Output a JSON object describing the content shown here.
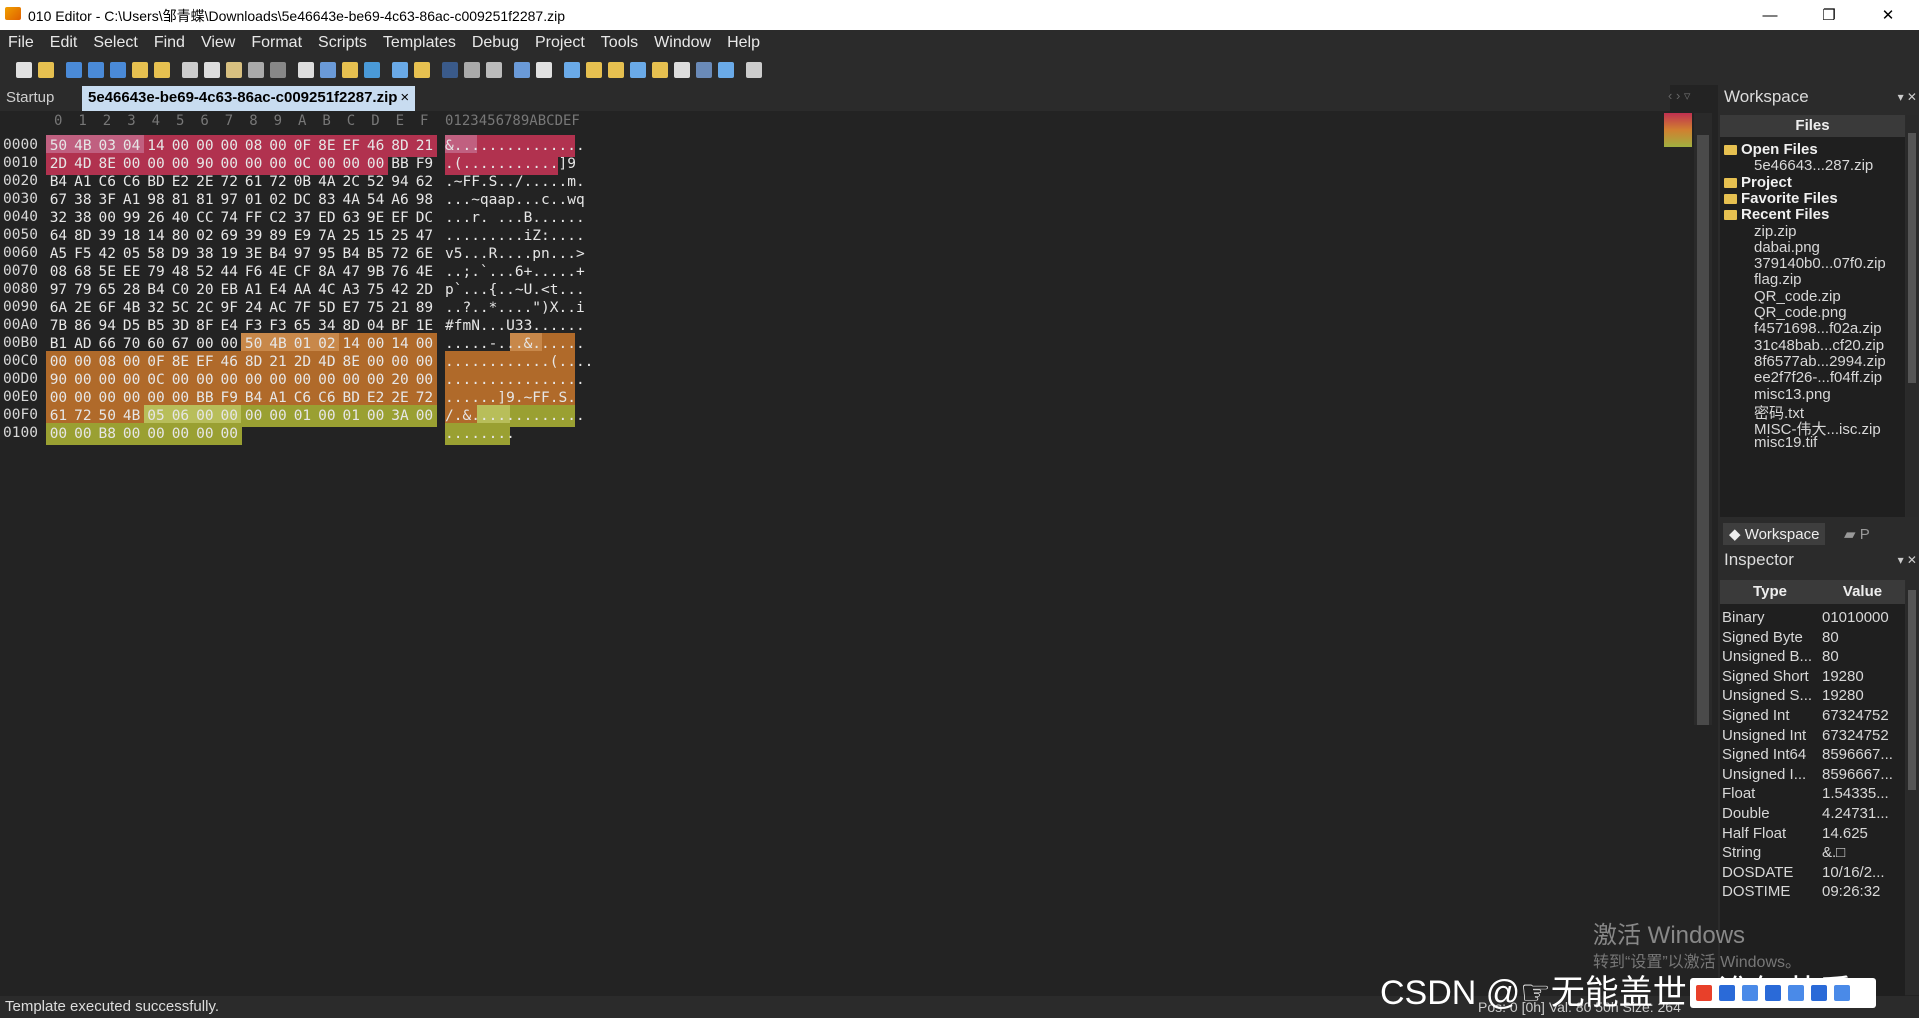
{
  "window": {
    "title": "010 Editor - C:\\Users\\邹青蝶\\Downloads\\5e46643e-be69-4c63-86ac-c009251f2287.zip"
  },
  "menu": [
    "File",
    "Edit",
    "Select",
    "Find",
    "View",
    "Format",
    "Scripts",
    "Templates",
    "Debug",
    "Project",
    "Tools",
    "Window",
    "Help"
  ],
  "tabs": {
    "startup": "Startup",
    "file": "5e46643e-be69-4c63-86ac-c009251f2287.zip",
    "close": "×"
  },
  "hex": {
    "col_headers": [
      "0",
      "1",
      "2",
      "3",
      "4",
      "5",
      "6",
      "7",
      "8",
      "9",
      "A",
      "B",
      "C",
      "D",
      "E",
      "F"
    ],
    "ascii_header": "0123456789ABCDEF",
    "rows": [
      {
        "offset": "0000",
        "bytes": [
          "50",
          "4B",
          "03",
          "04",
          "14",
          "00",
          "00",
          "00",
          "08",
          "00",
          "0F",
          "8E",
          "EF",
          "46",
          "8D",
          "21"
        ],
        "ascii": "&..............."
      },
      {
        "offset": "0010",
        "bytes": [
          "2D",
          "4D",
          "8E",
          "00",
          "00",
          "00",
          "90",
          "00",
          "00",
          "00",
          "0C",
          "00",
          "00",
          "00",
          "BB",
          "F9"
        ],
        "ascii": ".(...........]9"
      },
      {
        "offset": "0020",
        "bytes": [
          "B4",
          "A1",
          "C6",
          "C6",
          "BD",
          "E2",
          "2E",
          "72",
          "61",
          "72",
          "0B",
          "4A",
          "2C",
          "52",
          "94",
          "62"
        ],
        "ascii": ".~FF.S../.....m."
      },
      {
        "offset": "0030",
        "bytes": [
          "67",
          "38",
          "3F",
          "A1",
          "98",
          "81",
          "81",
          "97",
          "01",
          "02",
          "DC",
          "83",
          "4A",
          "54",
          "A6",
          "98"
        ],
        "ascii": "...~qaap...c..wq"
      },
      {
        "offset": "0040",
        "bytes": [
          "32",
          "38",
          "00",
          "99",
          "26",
          "40",
          "CC",
          "74",
          "FF",
          "C2",
          "37",
          "ED",
          "63",
          "9E",
          "EF",
          "DC"
        ],
        "ascii": "...r. ...B......"
      },
      {
        "offset": "0050",
        "bytes": [
          "64",
          "8D",
          "39",
          "18",
          "14",
          "80",
          "02",
          "69",
          "39",
          "89",
          "E9",
          "7A",
          "25",
          "15",
          "25",
          "47"
        ],
        "ascii": ".........iZ:...."
      },
      {
        "offset": "0060",
        "bytes": [
          "A5",
          "F5",
          "42",
          "05",
          "58",
          "D9",
          "38",
          "19",
          "3E",
          "B4",
          "97",
          "95",
          "B4",
          "B5",
          "72",
          "6E"
        ],
        "ascii": "v5...R....pn...>"
      },
      {
        "offset": "0070",
        "bytes": [
          "08",
          "68",
          "5E",
          "EE",
          "79",
          "48",
          "52",
          "44",
          "F6",
          "4E",
          "CF",
          "8A",
          "47",
          "9B",
          "76",
          "4E"
        ],
        "ascii": "..;.`...6+.....+"
      },
      {
        "offset": "0080",
        "bytes": [
          "97",
          "79",
          "65",
          "28",
          "B4",
          "C0",
          "20",
          "EB",
          "A1",
          "E4",
          "AA",
          "4C",
          "A3",
          "75",
          "42",
          "2D"
        ],
        "ascii": "p`...{..~U.<t..."
      },
      {
        "offset": "0090",
        "bytes": [
          "6A",
          "2E",
          "6F",
          "4B",
          "32",
          "5C",
          "2C",
          "9F",
          "24",
          "AC",
          "7F",
          "5D",
          "E7",
          "75",
          "21",
          "89"
        ],
        "ascii": "..?..*....\")X..i"
      },
      {
        "offset": "00A0",
        "bytes": [
          "7B",
          "86",
          "94",
          "D5",
          "B5",
          "3D",
          "8F",
          "E4",
          "F3",
          "F3",
          "65",
          "34",
          "8D",
          "04",
          "BF",
          "1E"
        ],
        "ascii": "#fmN...U33......"
      },
      {
        "offset": "00B0",
        "bytes": [
          "B1",
          "AD",
          "66",
          "70",
          "60",
          "67",
          "00",
          "00",
          "50",
          "4B",
          "01",
          "02",
          "14",
          "00",
          "14",
          "00"
        ],
        "ascii": ".....-...&......"
      },
      {
        "offset": "00C0",
        "bytes": [
          "00",
          "00",
          "08",
          "00",
          "0F",
          "8E",
          "EF",
          "46",
          "8D",
          "21",
          "2D",
          "4D",
          "8E",
          "00",
          "00",
          "00"
        ],
        "ascii": "............(...."
      },
      {
        "offset": "00D0",
        "bytes": [
          "90",
          "00",
          "00",
          "00",
          "0C",
          "00",
          "00",
          "00",
          "00",
          "00",
          "00",
          "00",
          "00",
          "00",
          "20",
          "00"
        ],
        "ascii": "................"
      },
      {
        "offset": "00E0",
        "bytes": [
          "00",
          "00",
          "00",
          "00",
          "00",
          "00",
          "BB",
          "F9",
          "B4",
          "A1",
          "C6",
          "C6",
          "BD",
          "E2",
          "2E",
          "72"
        ],
        "ascii": "......]9.~FF.S."
      },
      {
        "offset": "00F0",
        "bytes": [
          "61",
          "72",
          "50",
          "4B",
          "05",
          "06",
          "00",
          "00",
          "00",
          "00",
          "01",
          "00",
          "01",
          "00",
          "3A",
          "00"
        ],
        "ascii": "/.&............."
      },
      {
        "offset": "0100",
        "bytes": [
          "00",
          "00",
          "B8",
          "00",
          "00",
          "00",
          "00",
          "00"
        ],
        "ascii": "........"
      }
    ]
  },
  "workspace": {
    "title": "Workspace",
    "files_header": "Files",
    "items": [
      {
        "label": "Open Files",
        "type": "category"
      },
      {
        "label": "5e46643...287.zip",
        "type": "item"
      },
      {
        "label": "Project",
        "type": "category"
      },
      {
        "label": "Favorite Files",
        "type": "category"
      },
      {
        "label": "Recent Files",
        "type": "category"
      },
      {
        "label": "zip.zip",
        "type": "item"
      },
      {
        "label": "dabai.png",
        "type": "item"
      },
      {
        "label": "379140b0...07f0.zip",
        "type": "item"
      },
      {
        "label": "flag.zip",
        "type": "item"
      },
      {
        "label": "QR_code.zip",
        "type": "item"
      },
      {
        "label": "QR_code.png",
        "type": "item"
      },
      {
        "label": "f4571698...f02a.zip",
        "type": "item"
      },
      {
        "label": "31c48bab...cf20.zip",
        "type": "item"
      },
      {
        "label": "8f6577ab...2994.zip",
        "type": "item"
      },
      {
        "label": "ee2f7f26-...f04ff.zip",
        "type": "item"
      },
      {
        "label": "misc13.png",
        "type": "item"
      },
      {
        "label": "密码.txt",
        "type": "item"
      },
      {
        "label": "MISC-伟大...isc.zip",
        "type": "item"
      },
      {
        "label": "misc19.tif",
        "type": "item"
      }
    ],
    "tab_workspace": "Workspace",
    "tab_other": "P"
  },
  "inspector": {
    "title": "Inspector",
    "col_type": "Type",
    "col_value": "Value",
    "rows": [
      {
        "type": "Binary",
        "value": "01010000"
      },
      {
        "type": "Signed Byte",
        "value": "80"
      },
      {
        "type": "Unsigned B...",
        "value": "80"
      },
      {
        "type": "Signed Short",
        "value": "19280"
      },
      {
        "type": "Unsigned S...",
        "value": "19280"
      },
      {
        "type": "Signed Int",
        "value": "67324752"
      },
      {
        "type": "Unsigned Int",
        "value": "67324752"
      },
      {
        "type": "Signed Int64",
        "value": "8596667..."
      },
      {
        "type": "Unsigned I...",
        "value": "8596667..."
      },
      {
        "type": "Float",
        "value": "1.54335..."
      },
      {
        "type": "Double",
        "value": "4.24731..."
      },
      {
        "type": "Half Float",
        "value": "14.625"
      },
      {
        "type": "String",
        "value": "&.□"
      },
      {
        "type": "DOSDATE",
        "value": "10/16/2..."
      },
      {
        "type": "DOSTIME",
        "value": "09:26:32"
      }
    ]
  },
  "status": {
    "message": "Template executed successfully.",
    "position": "Pos: 0 [0h]  Val: 80 50h  Size: 264"
  },
  "overlay": {
    "watermark": "CSDN @☞无能盖世 · 谁何苦乖",
    "win_activate": "激活 Windows",
    "win_activate_sub": "转到“设置”以激活 Windows。"
  },
  "colors": {
    "pink": "#b1324f",
    "pink_light": "#c06080",
    "orange": "#b06a2a",
    "orange_light": "#c8884a",
    "olive": "#9aa032",
    "olive_light": "#b8be5a",
    "accent_tab": "#c8dcf0"
  }
}
